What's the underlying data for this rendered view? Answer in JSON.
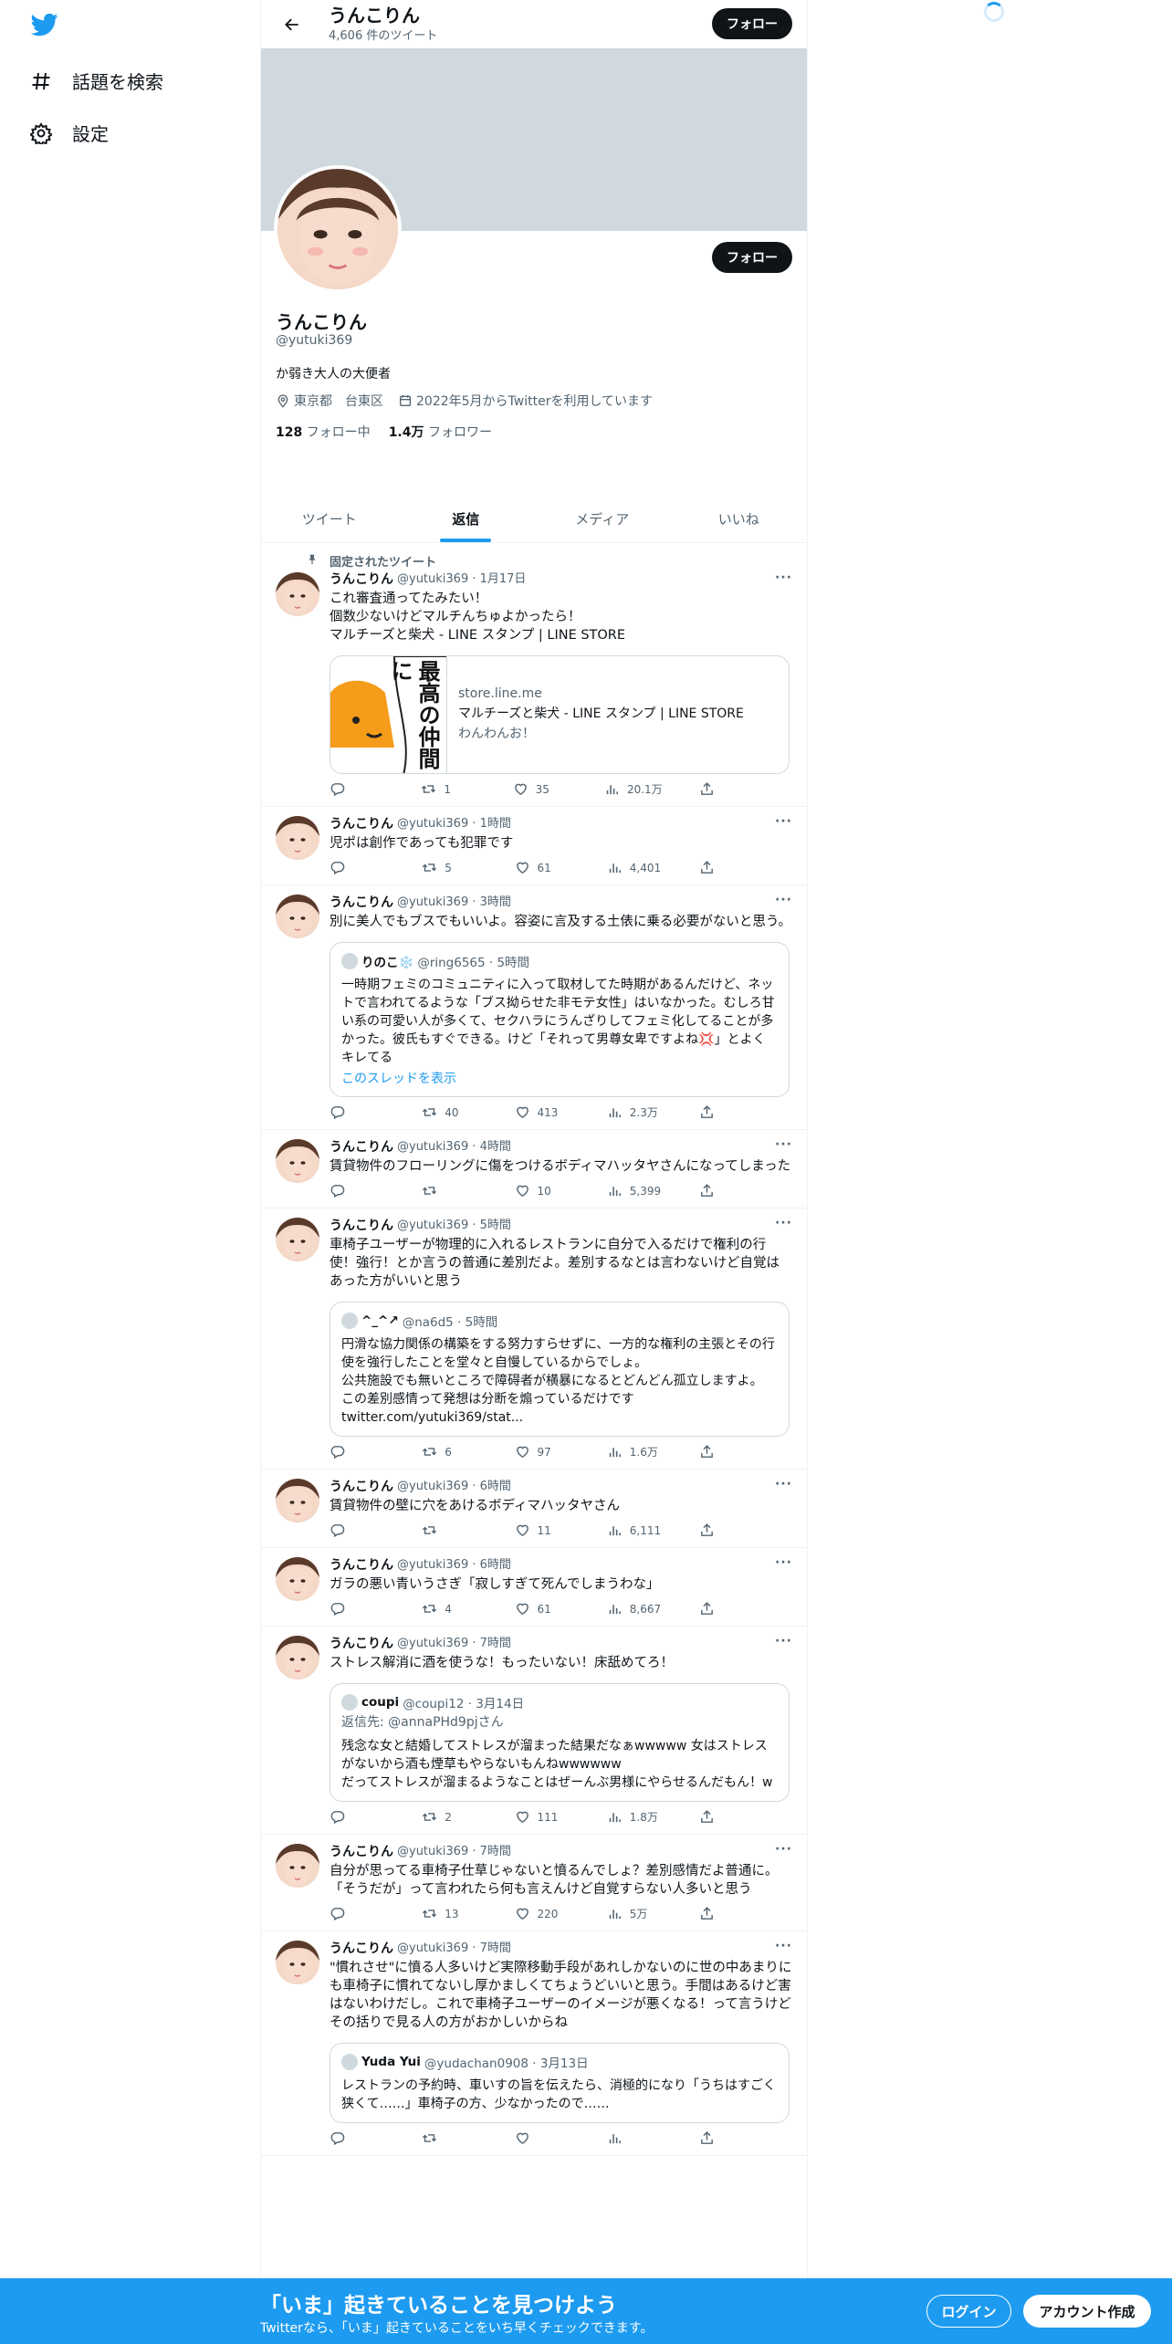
{
  "nav": {
    "explore": "話題を検索",
    "settings": "設定"
  },
  "header": {
    "name": "うんこりん",
    "tweet_count": "4,606 件のツイート",
    "follow": "フォロー"
  },
  "profile": {
    "name": "うんこりん",
    "handle": "@yutuki369",
    "bio": "か弱き大人の大便者",
    "location": "東京都　台東区",
    "joined": "2022年5月からTwitterを利用しています",
    "following_count": "128",
    "following_label": "フォロー中",
    "followers_count": "1.4万",
    "followers_label": "フォロワー",
    "follow": "フォロー"
  },
  "tabs": [
    "ツイート",
    "返信",
    "メディア",
    "いいね"
  ],
  "pinned_label": "固定されたツイート",
  "tweets": [
    {
      "name": "うんこりん",
      "meta": "@yutuki369 · 1月17日",
      "text": "これ審査通ってたみたい！\n個数少ないけどマルチんちゅよかったら！\nマルチーズと柴犬 - LINE スタンプ | LINE STORE",
      "card": {
        "domain": "store.line.me",
        "title": "マルチーズと柴犬 - LINE スタンプ | LINE STORE",
        "desc": "わんわんお！",
        "img_text": "最高の仲間に"
      },
      "reply": "",
      "rt": "1",
      "like": "35",
      "views": "20.1万"
    },
    {
      "name": "うんこりん",
      "meta": "@yutuki369 · 1時間",
      "text": "児ポは創作であっても犯罪です",
      "reply": "",
      "rt": "5",
      "like": "61",
      "views": "4,401"
    },
    {
      "name": "うんこりん",
      "meta": "@yutuki369 · 3時間",
      "text": "別に美人でもブスでもいいよ。容姿に言及する土俵に乗る必要がないと思う。",
      "quote": {
        "name": "りのこ❄️",
        "handle": "@ring6565 · 5時間",
        "text": "一時期フェミのコミュニティに入って取材してた時期があるんだけど、ネットで言われてるような「ブス拗らせた非モテ女性」はいなかった。むしろ甘い系の可愛い人が多くて、セクハラにうんざりしてフェミ化してることが多かった。彼氏もすぐできる。けど「それって男尊女卑ですよね💢」とよくキレてる",
        "link": "このスレッドを表示"
      },
      "reply": "",
      "rt": "40",
      "like": "413",
      "views": "2.3万"
    },
    {
      "name": "うんこりん",
      "meta": "@yutuki369 · 4時間",
      "text": "賃貸物件のフローリングに傷をつけるボディマハッタヤさんになってしまった",
      "reply": "",
      "rt": "",
      "like": "10",
      "views": "5,399"
    },
    {
      "name": "うんこりん",
      "meta": "@yutuki369 · 5時間",
      "text": "車椅子ユーザーが物理的に入れるレストランに自分で入るだけで権利の行使！強行！とか言うの普通に差別だよ。差別するなとは言わないけど自覚はあった方がいいと思う",
      "quote": {
        "name": "^_^↗",
        "handle": "@na6d5 · 5時間",
        "text": "円滑な協力関係の構築をする努力すらせずに、一方的な権利の主張とその行使を強行したことを堂々と自慢しているからでしょ。\n公共施設でも無いところで障碍者が横暴になるとどんどん孤立しますよ。\nこの差別感情って発想は分断を煽っているだけです\ntwitter.com/yutuki369/stat...",
        "link": ""
      },
      "reply": "",
      "rt": "6",
      "like": "97",
      "views": "1.6万"
    },
    {
      "name": "うんこりん",
      "meta": "@yutuki369 · 6時間",
      "text": "賃貸物件の壁に穴をあけるボディマハッタヤさん",
      "reply": "",
      "rt": "",
      "like": "11",
      "views": "6,111"
    },
    {
      "name": "うんこりん",
      "meta": "@yutuki369 · 6時間",
      "text": "ガラの悪い青いうさぎ「寂しすぎて死んでしまうわな」",
      "reply": "",
      "rt": "4",
      "like": "61",
      "views": "8,667"
    },
    {
      "name": "うんこりん",
      "meta": "@yutuki369 · 7時間",
      "text": "ストレス解消に酒を使うな！もったいない！床舐めてろ！",
      "quote": {
        "name": "coupi",
        "handle": "@coupi12 · 3月14日",
        "reply_to": "返信先: @annaPHd9pjさん",
        "text": "残念な女と結婚してストレスが溜まった結果だなぁwwwww 女はストレスがないから酒も煙草もやらないもんねwwwwww\nだってストレスが溜まるようなことはぜーんぶ男様にやらせるんだもん！w",
        "link": ""
      },
      "reply": "",
      "rt": "2",
      "like": "111",
      "views": "1.8万"
    },
    {
      "name": "うんこりん",
      "meta": "@yutuki369 · 7時間",
      "text": "自分が思ってる車椅子仕草じゃないと憤るんでしょ？差別感情だよ普通に。「そうだが」って言われたら何も言えんけど自覚すらない人多いと思う",
      "reply": "",
      "rt": "13",
      "like": "220",
      "views": "5万"
    },
    {
      "name": "うんこりん",
      "meta": "@yutuki369 · 7時間",
      "text": "\"慣れさせ\"に憤る人多いけど実際移動手段があれしかないのに世の中あまりにも車椅子に慣れてないし厚かましくてちょうどいいと思う。手間はあるけど害はないわけだし。これで車椅子ユーザーのイメージが悪くなる！って言うけどその括りで見る人の方がおかしいからね",
      "quote": {
        "name": "Yuda Yui",
        "handle": "@yudachan0908 · 3月13日",
        "text": "レストランの予約時、車いすの旨を伝えたら、消極的になり「うちはすごく狭くて……」車椅子の方、少なかったので……",
        "link": ""
      },
      "reply": "",
      "rt": "",
      "like": "",
      "views": ""
    }
  ],
  "bottom": {
    "title": "「いま」起きていることを見つけよう",
    "subtitle": "Twitterなら、「いま」起きていることをいち早くチェックできます。",
    "login": "ログイン",
    "signup": "アカウント作成"
  },
  "colors": {
    "accent": "#1d9bf0",
    "text": "#0f1419",
    "muted": "#536471"
  }
}
